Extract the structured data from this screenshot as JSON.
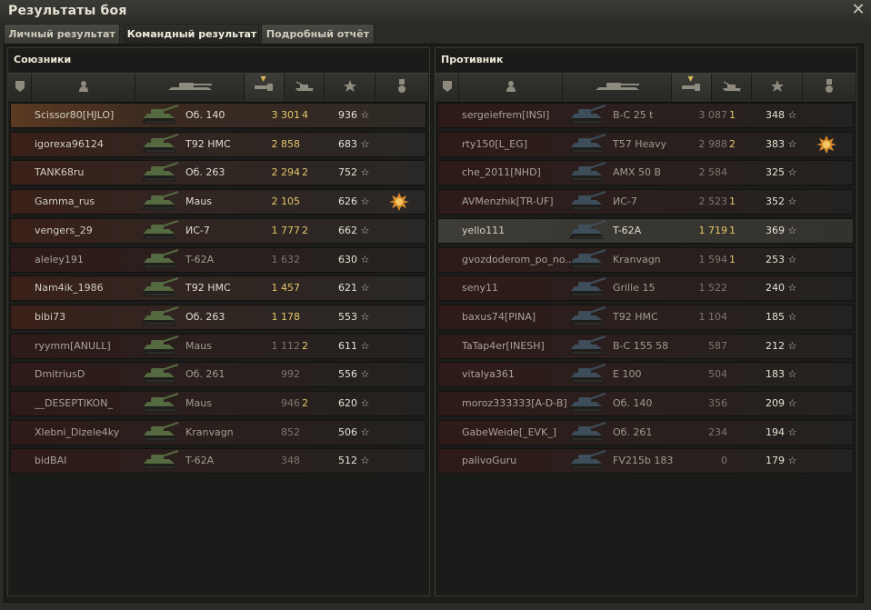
{
  "window": {
    "title": "Результаты боя",
    "close_glyph": "✕"
  },
  "tabs": [
    {
      "label": "Личный результат"
    },
    {
      "label": "Командный результат"
    },
    {
      "label": "Подробный отчёт"
    }
  ],
  "allies": {
    "title": "Союзники",
    "rows": [
      {
        "name": "Scissor80[HJLO]",
        "vehicle": "Об. 140",
        "damage": "3 301",
        "kills": "4",
        "xp": "936",
        "medal": false,
        "style": "self"
      },
      {
        "name": "igorexa96124",
        "vehicle": "T92 HMC",
        "damage": "2 858",
        "kills": "",
        "xp": "683",
        "medal": false,
        "style": "bright"
      },
      {
        "name": "TANK68ru",
        "vehicle": "Об. 263",
        "damage": "2 294",
        "kills": "2",
        "xp": "752",
        "medal": false,
        "style": "bright"
      },
      {
        "name": "Gamma_rus",
        "vehicle": "Maus",
        "damage": "2 105",
        "kills": "",
        "xp": "626",
        "medal": true,
        "style": "bright"
      },
      {
        "name": "vengers_29",
        "vehicle": "ИС-7",
        "damage": "1 777",
        "kills": "2",
        "xp": "662",
        "medal": false,
        "style": "bright"
      },
      {
        "name": "aleley191",
        "vehicle": "T-62A",
        "damage": "1 632",
        "kills": "",
        "xp": "630",
        "medal": false,
        "style": "dim"
      },
      {
        "name": "Nam4ik_1986",
        "vehicle": "T92 HMC",
        "damage": "1 457",
        "kills": "",
        "xp": "621",
        "medal": false,
        "style": "bright"
      },
      {
        "name": "bibi73",
        "vehicle": "Об. 263",
        "damage": "1 178",
        "kills": "",
        "xp": "553",
        "medal": false,
        "style": "bright"
      },
      {
        "name": "ryymm[ANULL]",
        "vehicle": "Maus",
        "damage": "1 112",
        "kills": "2",
        "xp": "611",
        "medal": false,
        "style": "dim"
      },
      {
        "name": "DmitriusD",
        "vehicle": "Об. 261",
        "damage": "992",
        "kills": "",
        "xp": "556",
        "medal": false,
        "style": "dim"
      },
      {
        "name": "__DESEPTIKON_",
        "vehicle": "Maus",
        "damage": "946",
        "kills": "2",
        "xp": "620",
        "medal": false,
        "style": "dim"
      },
      {
        "name": "Xlebni_Dizele4ky",
        "vehicle": "Kranvagn",
        "damage": "852",
        "kills": "",
        "xp": "506",
        "medal": false,
        "style": "dim"
      },
      {
        "name": "bidBAI",
        "vehicle": "T-62A",
        "damage": "348",
        "kills": "",
        "xp": "512",
        "medal": false,
        "style": "dim"
      }
    ]
  },
  "enemies": {
    "title": "Противник",
    "rows": [
      {
        "name": "sergeiefrem[INSI]",
        "vehicle": "B-C 25 t",
        "damage": "3 087",
        "kills": "1",
        "xp": "348",
        "medal": false,
        "style": "dim"
      },
      {
        "name": "rty150[L_EG]",
        "vehicle": "T57 Heavy",
        "damage": "2 988",
        "kills": "2",
        "xp": "383",
        "medal": true,
        "style": "dim"
      },
      {
        "name": "che_2011[NHD]",
        "vehicle": "AMX 50 B",
        "damage": "2 584",
        "kills": "",
        "xp": "325",
        "medal": false,
        "style": "dim"
      },
      {
        "name": "AVMenzhik[TR-UF]",
        "vehicle": "ИС-7",
        "damage": "2 523",
        "kills": "1",
        "xp": "352",
        "medal": false,
        "style": "dim"
      },
      {
        "name": "yello111",
        "vehicle": "T-62A",
        "damage": "1 719",
        "kills": "1",
        "xp": "369",
        "medal": false,
        "style": "hover"
      },
      {
        "name": "gvozdoderom_po_no...",
        "vehicle": "Kranvagn",
        "damage": "1 594",
        "kills": "1",
        "xp": "253",
        "medal": false,
        "style": "dim"
      },
      {
        "name": "seny11",
        "vehicle": "Grille 15",
        "damage": "1 522",
        "kills": "",
        "xp": "240",
        "medal": false,
        "style": "dim"
      },
      {
        "name": "baxus74[PINA]",
        "vehicle": "T92 HMC",
        "damage": "1 104",
        "kills": "",
        "xp": "185",
        "medal": false,
        "style": "dim"
      },
      {
        "name": "TaTap4er[INESH]",
        "vehicle": "B-C 155 58",
        "damage": "587",
        "kills": "",
        "xp": "212",
        "medal": false,
        "style": "dim"
      },
      {
        "name": "vitalya361",
        "vehicle": "E 100",
        "damage": "504",
        "kills": "",
        "xp": "183",
        "medal": false,
        "style": "dim"
      },
      {
        "name": "moroz333333[A-D-B]",
        "vehicle": "Об. 140",
        "damage": "356",
        "kills": "",
        "xp": "209",
        "medal": false,
        "style": "dim"
      },
      {
        "name": "GabeWeide[_EVK_]",
        "vehicle": "Об. 261",
        "damage": "234",
        "kills": "",
        "xp": "194",
        "medal": false,
        "style": "dim"
      },
      {
        "name": "palivoGuru",
        "vehicle": "FV215b 183",
        "damage": "0",
        "kills": "",
        "xp": "179",
        "medal": false,
        "style": "dim"
      }
    ]
  },
  "colors": {
    "ally_tank": "#556a40",
    "enemy_tank": "#3d4d5a",
    "damage_gold": "#e5c56a",
    "medal": "#d68a2a"
  },
  "icons": {
    "header": [
      "squad-icon",
      "player-icon",
      "vehicle-icon",
      "damage-icon",
      "kills-icon",
      "xp-icon",
      "medal-icon"
    ],
    "row": [
      "tank-icon",
      "xp-star-icon",
      "medal-icon"
    ]
  }
}
